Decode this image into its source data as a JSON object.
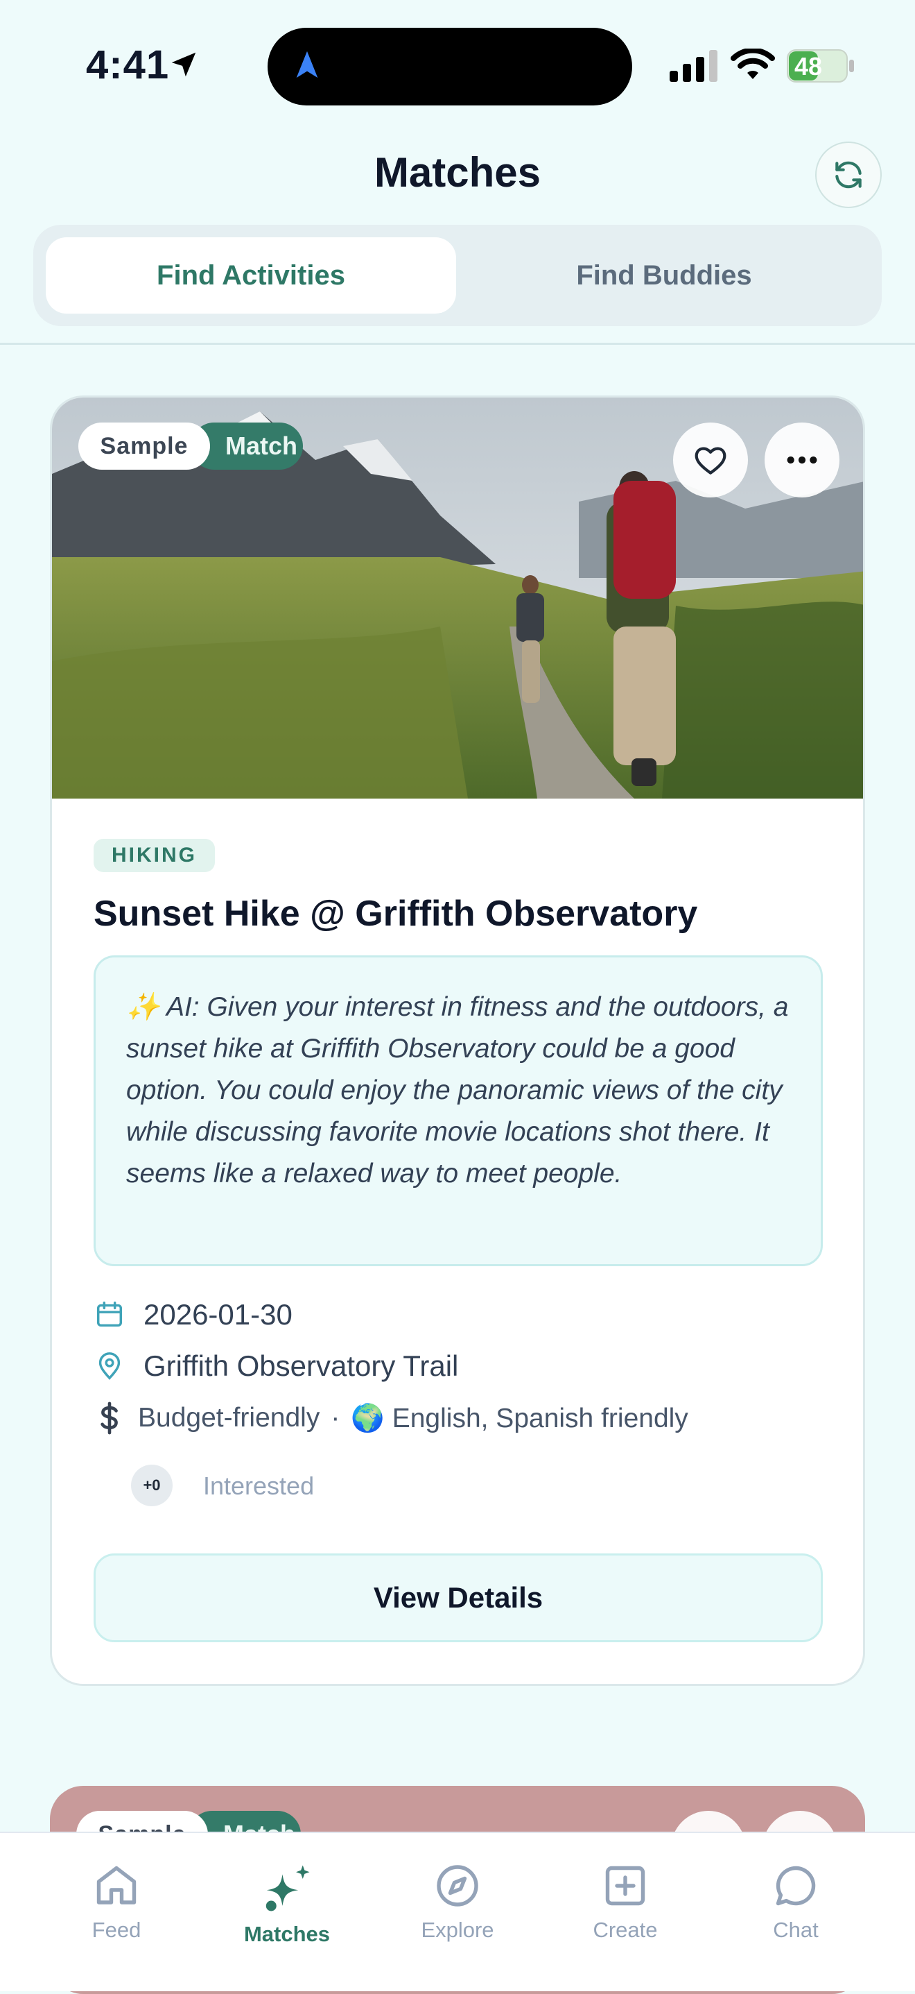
{
  "status_bar": {
    "time": "4:41",
    "battery": "48"
  },
  "header": {
    "title": "Matches"
  },
  "tabs": [
    {
      "label": "Find Activities",
      "active": true
    },
    {
      "label": "Find Buddies",
      "active": false
    }
  ],
  "card": {
    "badge_sample": "Sample",
    "badge_match": "Match",
    "category": "HIKING",
    "title": "Sunset Hike @ Griffith Observatory",
    "ai_text": "✨ AI: Given your interest in fitness and the outdoors, a sunset hike at Griffith Observatory could be a good option. You could enjoy the panoramic views of the city while discussing favorite movie locations shot there. It seems like a relaxed way to meet people.",
    "date": "2026-01-30",
    "location": "Griffith Observatory Trail",
    "budget": "Budget-friendly",
    "separator": "·",
    "language": "🌍 English, Spanish friendly",
    "interested_count": "+0",
    "interested_label": "Interested",
    "details_button": "View Details"
  },
  "next_card": {
    "badge_sample": "Sample",
    "badge_match": "Match"
  },
  "nav": [
    {
      "label": "Feed",
      "icon": "home-icon",
      "active": false
    },
    {
      "label": "Matches",
      "icon": "sparkle-icon",
      "active": true
    },
    {
      "label": "Explore",
      "icon": "compass-icon",
      "active": false
    },
    {
      "label": "Create",
      "icon": "plus-square-icon",
      "active": false
    },
    {
      "label": "Chat",
      "icon": "chat-icon",
      "active": false
    }
  ],
  "colors": {
    "accent": "#2e7866",
    "background": "#eefbfb",
    "ai_box": "#ecfafa"
  }
}
